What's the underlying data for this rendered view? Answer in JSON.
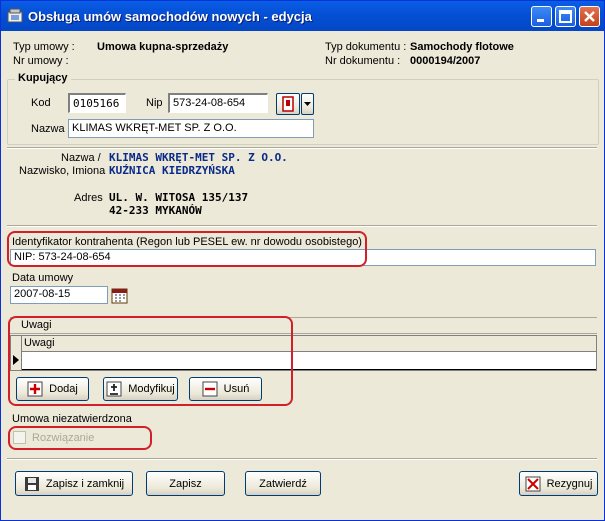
{
  "window": {
    "title": "Obsługa umów samochodów nowych - edycja",
    "app_icon_label": "DMS"
  },
  "header": {
    "typ_umowy_label": "Typ umowy :",
    "typ_umowy_value": "Umowa kupna-sprzedaży",
    "nr_umowy_label": "Nr umowy :",
    "typ_dokumentu_label": "Typ dokumentu :",
    "typ_dokumentu_value": "Samochody flotowe",
    "nr_dokumentu_label": "Nr dokumentu :",
    "nr_dokumentu_value": "0000194/2007"
  },
  "kupujacy": {
    "group_label": "Kupujący",
    "kod_label": "Kod",
    "kod_value": "0105166",
    "nip_label": "Nip",
    "nip_value": "573-24-08-654",
    "nazwa_label": "Nazwa",
    "nazwa_value": "KLIMAS WKRĘT-MET SP. Z O.O."
  },
  "details": {
    "nazwa_label": "Nazwa /",
    "nazwisko_label": "Nazwisko, Imiona",
    "nazwa_value": "KLIMAS WKRĘT-MET SP. Z O.O.",
    "nazwisko_value": "KUŹNICA KIEDRZYŃSKA",
    "adres_label": "Adres",
    "adres_line1": "UL. W. WITOSA 135/137",
    "adres_line2": "42-233 MYKANÓW"
  },
  "identyfikator": {
    "label": "Identyfikator kontrahenta (Regon lub PESEL ew. nr dowodu osobistego)",
    "value": "NIP:  573-24-08-654"
  },
  "data_umowy": {
    "label": "Data umowy",
    "value": "2007-08-15"
  },
  "uwagi": {
    "tab_label": "Uwagi",
    "column_header": "Uwagi",
    "buttons": {
      "dodaj": "Dodaj",
      "modyfikuj": "Modyfikuj",
      "usun": "Usuń"
    }
  },
  "status": {
    "label": "Umowa niezatwierdzona",
    "rozwiazanie_label": "Rozwiązanie",
    "rozwiazanie_checked": false
  },
  "footer": {
    "zapisz_zamknij": "Zapisz i zamknij",
    "zapisz": "Zapisz",
    "zatwierdz": "Zatwierdź",
    "rezygnuj": "Rezygnuj"
  },
  "colors": {
    "titlebar": "#0550d6",
    "highlight_box": "#d2202a",
    "dialog_bg": "#ece9d8",
    "value_blue": "#0a2a8a"
  },
  "icons": [
    "app-icon",
    "minimize-icon",
    "maximize-icon",
    "close-icon",
    "search-icon",
    "dropdown-arrow-icon",
    "calendar-icon",
    "add-icon",
    "modify-icon",
    "delete-icon",
    "save-icon",
    "cancel-icon",
    "row-pointer-icon"
  ]
}
